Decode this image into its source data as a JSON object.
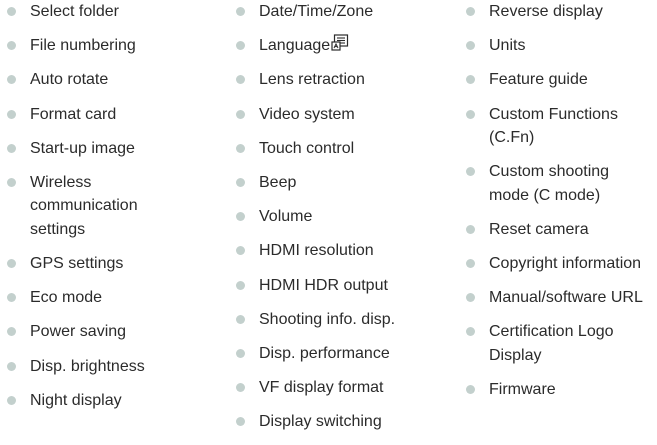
{
  "colors": {
    "bullet": "#c3d0cd",
    "text": "#2b2b2b",
    "background": "#ffffff"
  },
  "columns": [
    {
      "items": [
        {
          "label": "Select folder"
        },
        {
          "label": "File numbering"
        },
        {
          "label": "Auto rotate"
        },
        {
          "label": "Format card"
        },
        {
          "label": "Start-up image"
        },
        {
          "label": "Wireless communication settings"
        },
        {
          "label": "GPS settings"
        },
        {
          "label": "Eco mode"
        },
        {
          "label": "Power saving"
        },
        {
          "label": "Disp. brightness"
        },
        {
          "label": "Night display"
        }
      ]
    },
    {
      "items": [
        {
          "label": "Date/Time/Zone"
        },
        {
          "label": "Language",
          "icon": "language-icon"
        },
        {
          "label": "Lens retraction"
        },
        {
          "label": "Video system"
        },
        {
          "label": "Touch control"
        },
        {
          "label": "Beep"
        },
        {
          "label": "Volume"
        },
        {
          "label": "HDMI resolution"
        },
        {
          "label": "HDMI HDR output"
        },
        {
          "label": "Shooting info. disp."
        },
        {
          "label": "Disp. performance"
        },
        {
          "label": "VF display format"
        },
        {
          "label": "Display switching"
        }
      ]
    },
    {
      "items": [
        {
          "label": "Reverse display"
        },
        {
          "label": "Units"
        },
        {
          "label": "Feature guide"
        },
        {
          "label": "Custom Functions (C.Fn)"
        },
        {
          "label": "Custom shooting mode (C mode)"
        },
        {
          "label": "Reset camera"
        },
        {
          "label": "Copyright information"
        },
        {
          "label": "Manual/software URL"
        },
        {
          "label": "Certification Logo Display"
        },
        {
          "label": "Firmware"
        }
      ]
    }
  ]
}
